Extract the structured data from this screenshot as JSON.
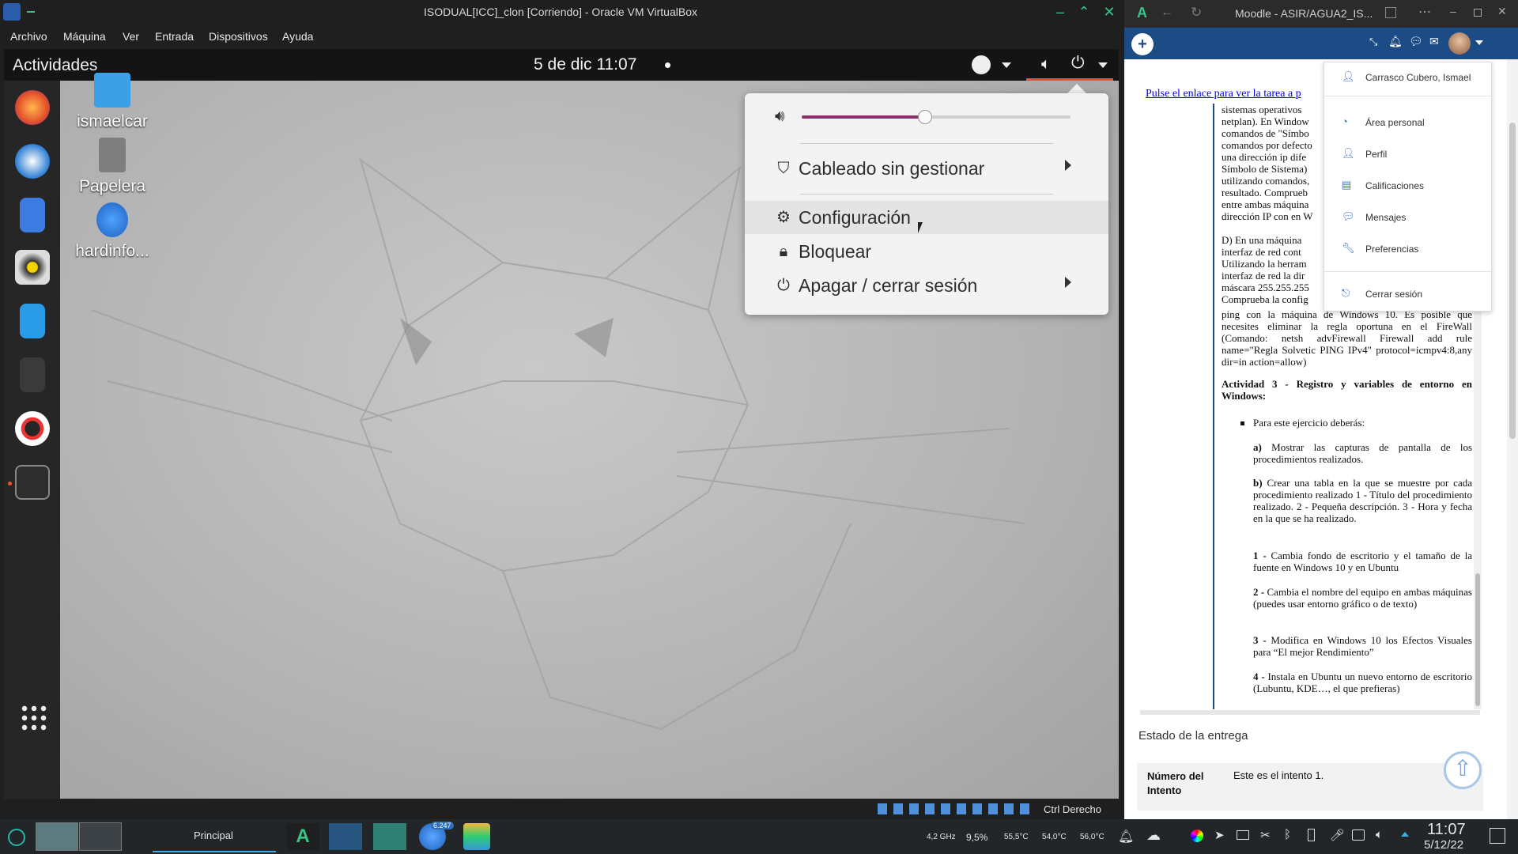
{
  "vbox": {
    "title": "ISODUAL[ICC]_clon [Corriendo] - Oracle VM VirtualBox",
    "menu": [
      "Archivo",
      "Máquina",
      "Ver",
      "Entrada",
      "Dispositivos",
      "Ayuda"
    ],
    "host_key": "Ctrl Derecho"
  },
  "gnome": {
    "activities": "Actividades",
    "datetime": "5 de dic  11:07",
    "desktop_icons": [
      {
        "label": "ismaelcar"
      },
      {
        "label": "Papelera"
      },
      {
        "label": "hardinfo..."
      }
    ],
    "volume_level": 0.46,
    "menu": {
      "network": "Cableado sin gestionar",
      "settings": "Configuración",
      "lock": "Bloquear",
      "power": "Apagar / cerrar sesión"
    }
  },
  "browser": {
    "title": "Moodle - ASIR/AGUA2_IS...",
    "link_text": "Pulse el enlace para ver la tarea a p",
    "user_menu": {
      "name": "Carrasco Cubero, Ismael",
      "items": [
        "Área personal",
        "Perfil",
        "Calificaciones",
        "Mensajes",
        "Preferencias"
      ],
      "logout": "Cerrar sesión"
    },
    "text_lines_left": [
      "sistemas operativos",
      "netplan). En Window",
      "comandos de \"Símbo",
      "comandos por defecto",
      "una dirección ip dife",
      "Símbolo de Sistema)",
      "utilizando comandos,",
      "resultado. Comprueb",
      "entre ambas máquina",
      "dirección IP con en W"
    ],
    "d_lines": [
      "D) En una máquina",
      "interfaz de red cont",
      "Utilizando la herram",
      "interfaz de red la dir",
      "máscara 255.255.255",
      "Comprueba la config"
    ],
    "ping_text": "ping con la máquina de Windows 10. Es posible que necesites eliminar la regla oportuna en el FireWall (Comando: netsh advFirewall Firewall add rule name=\"Regla Solvetic PING IPv4\" protocol=icmpv4:8,any dir=in action=allow)",
    "activity3_title": "Actividad 3 - Registro y variables de entorno en Windows:",
    "bullet": "Para este ejercicio deberás:",
    "a_label": "a)",
    "a_text": " Mostrar las capturas de pantalla de los procedimientos realizados.",
    "b_label": "b)",
    "b_text": " Crear una tabla en la que se muestre por cada procedimiento realizado 1 - Título del procedimiento realizado. 2 - Pequeña descripción. 3 - Hora y fecha en la que se ha realizado.",
    "t1_label": "1 -",
    "t1_text": " Cambia fondo de escritorio y el tamaño de la fuente en Windows 10 y en Ubuntu",
    "t2_label": "2 -",
    "t2_text": " Cambia el nombre del equipo en ambas máquinas (puedes usar entorno gráfico o de texto)",
    "t3_label": "3 -",
    "t3_text": " Modifica en Windows 10 los Efectos Visuales para “El mejor Rendimiento”",
    "t4_label": "4 -",
    "t4_text": " Instala en Ubuntu un nuevo entorno de escritorio (Lubuntu, KDE…, el que prefieras)",
    "estado": "Estado de la entrega",
    "intento_label": "Número del Intento",
    "intento_value": "Este es el intento 1."
  },
  "taskbar": {
    "principal": "Principal",
    "badge": "6.247",
    "cpu_freq": "4,2 GHz",
    "cpu_load": "9,5%",
    "temp1": "55,5°C",
    "temp2": "54,0°C",
    "temp3": "56,0°C",
    "time": "11:07",
    "date": "5/12/22"
  },
  "colors": {
    "accent_vbox": "#39c48a",
    "moodle_nav": "#1c4b86",
    "volume": "#8b2f6b"
  }
}
